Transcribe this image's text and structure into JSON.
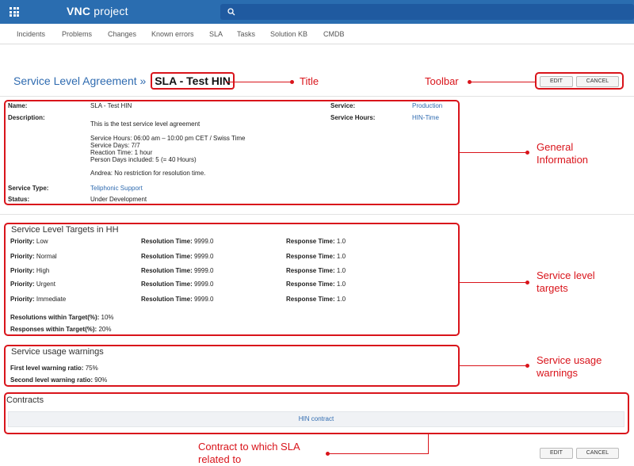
{
  "app": {
    "brand_prefix": "VNC",
    "brand_suffix": "project"
  },
  "nav": [
    "Incidents",
    "Problems",
    "Changes",
    "Known errors",
    "SLA",
    "Tasks",
    "Solution KB",
    "CMDB"
  ],
  "breadcrumb": {
    "parent": "Service Level Agreement",
    "separator": "»",
    "current": "SLA - Test HIN"
  },
  "toolbar": {
    "edit": "EDIT",
    "cancel": "CANCEL"
  },
  "general": {
    "name_label": "Name:",
    "name": "SLA - Test HIN",
    "description_label": "Description:",
    "description_lines": [
      "This is the test service level agreement",
      "Service Hours: 06:00 am – 10:00 pm CET / Swiss Time",
      "Service Days: 7/7",
      "Reaction Time: 1 hour",
      "Person Days included: 5 (= 40 Hours)",
      "Andrea: No restriction for resolution time."
    ],
    "service_type_label": "Service Type:",
    "service_type": "Teliphonic Support",
    "status_label": "Status:",
    "status": "Under Development",
    "service_label": "Service:",
    "service": "Production",
    "service_hours_label": "Service Hours:",
    "service_hours": "HIN-Time"
  },
  "targets": {
    "title": "Service Level Targets in HH",
    "rows": [
      {
        "priority": "Low",
        "resolution": "9999.0",
        "response": "1.0"
      },
      {
        "priority": "Normal",
        "resolution": "9999.0",
        "response": "1.0"
      },
      {
        "priority": "High",
        "resolution": "9999.0",
        "response": "1.0"
      },
      {
        "priority": "Urgent",
        "resolution": "9999.0",
        "response": "1.0"
      },
      {
        "priority": "Immediate",
        "resolution": "9999.0",
        "response": "1.0"
      }
    ],
    "priority_label": "Priority:",
    "resolution_label": "Resolution Time:",
    "response_label": "Response Time:",
    "resolutions_within_label": "Resolutions within Target(%):",
    "resolutions_within": "10%",
    "responses_within_label": "Responses within Target(%):",
    "responses_within": "20%"
  },
  "warnings": {
    "title": "Service usage warnings",
    "first_label": "First level warning ratio:",
    "first": "75%",
    "second_label": "Second level warning ratio:",
    "second": "90%"
  },
  "contracts": {
    "title": "Contracts",
    "item": "HIN contract"
  },
  "annotations": {
    "title": "Title",
    "toolbar": "Toolbar",
    "general_1": "General",
    "general_2": "Information",
    "targets_1": "Service level",
    "targets_2": "targets",
    "warnings_1": "Service usage",
    "warnings_2": "warnings",
    "contract_1": "Contract to which SLA",
    "contract_2": "related to"
  },
  "colors": {
    "topbar": "#2a6db0",
    "link": "#2f6bb0",
    "annotation": "#d9141b"
  }
}
